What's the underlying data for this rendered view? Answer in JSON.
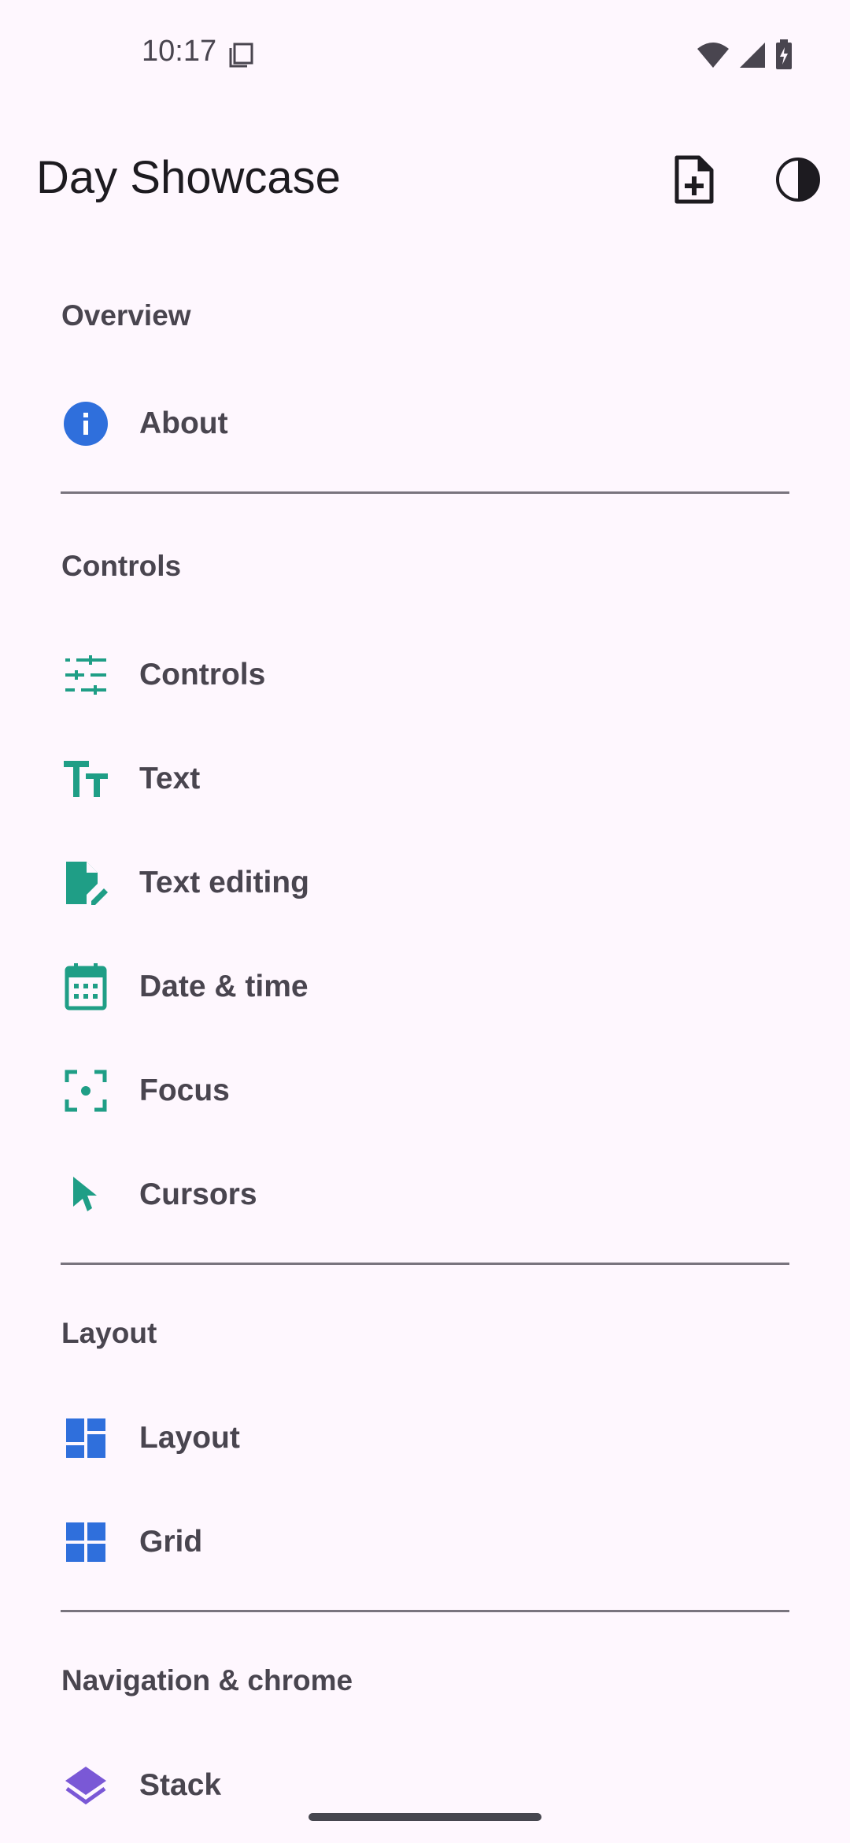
{
  "status_bar": {
    "time": "10:17"
  },
  "app_bar": {
    "title": "Day Showcase",
    "actions": [
      {
        "name": "new-document",
        "icon": "note-add-icon"
      },
      {
        "name": "theme-toggle",
        "icon": "contrast-icon"
      }
    ]
  },
  "sections": [
    {
      "header": "Overview",
      "items": [
        {
          "label": "About",
          "icon": "info-icon",
          "color": "#2f6fdc"
        }
      ]
    },
    {
      "header": "Controls",
      "items": [
        {
          "label": "Controls",
          "icon": "tune-icon",
          "color": "#1f9e86"
        },
        {
          "label": "Text",
          "icon": "text-fields-icon",
          "color": "#1f9e86"
        },
        {
          "label": "Text editing",
          "icon": "edit-document-icon",
          "color": "#1f9e86"
        },
        {
          "label": "Date & time",
          "icon": "calendar-icon",
          "color": "#1f9e86"
        },
        {
          "label": "Focus",
          "icon": "focus-icon",
          "color": "#1f9e86"
        },
        {
          "label": "Cursors",
          "icon": "cursor-icon",
          "color": "#1f9e86"
        }
      ]
    },
    {
      "header": "Layout",
      "items": [
        {
          "label": "Layout",
          "icon": "dashboard-icon",
          "color": "#2f6fdc"
        },
        {
          "label": "Grid",
          "icon": "grid-icon",
          "color": "#2f6fdc"
        }
      ]
    },
    {
      "header": "Navigation & chrome",
      "items": [
        {
          "label": "Stack",
          "icon": "layers-icon",
          "color": "#7a58d6"
        }
      ]
    }
  ]
}
